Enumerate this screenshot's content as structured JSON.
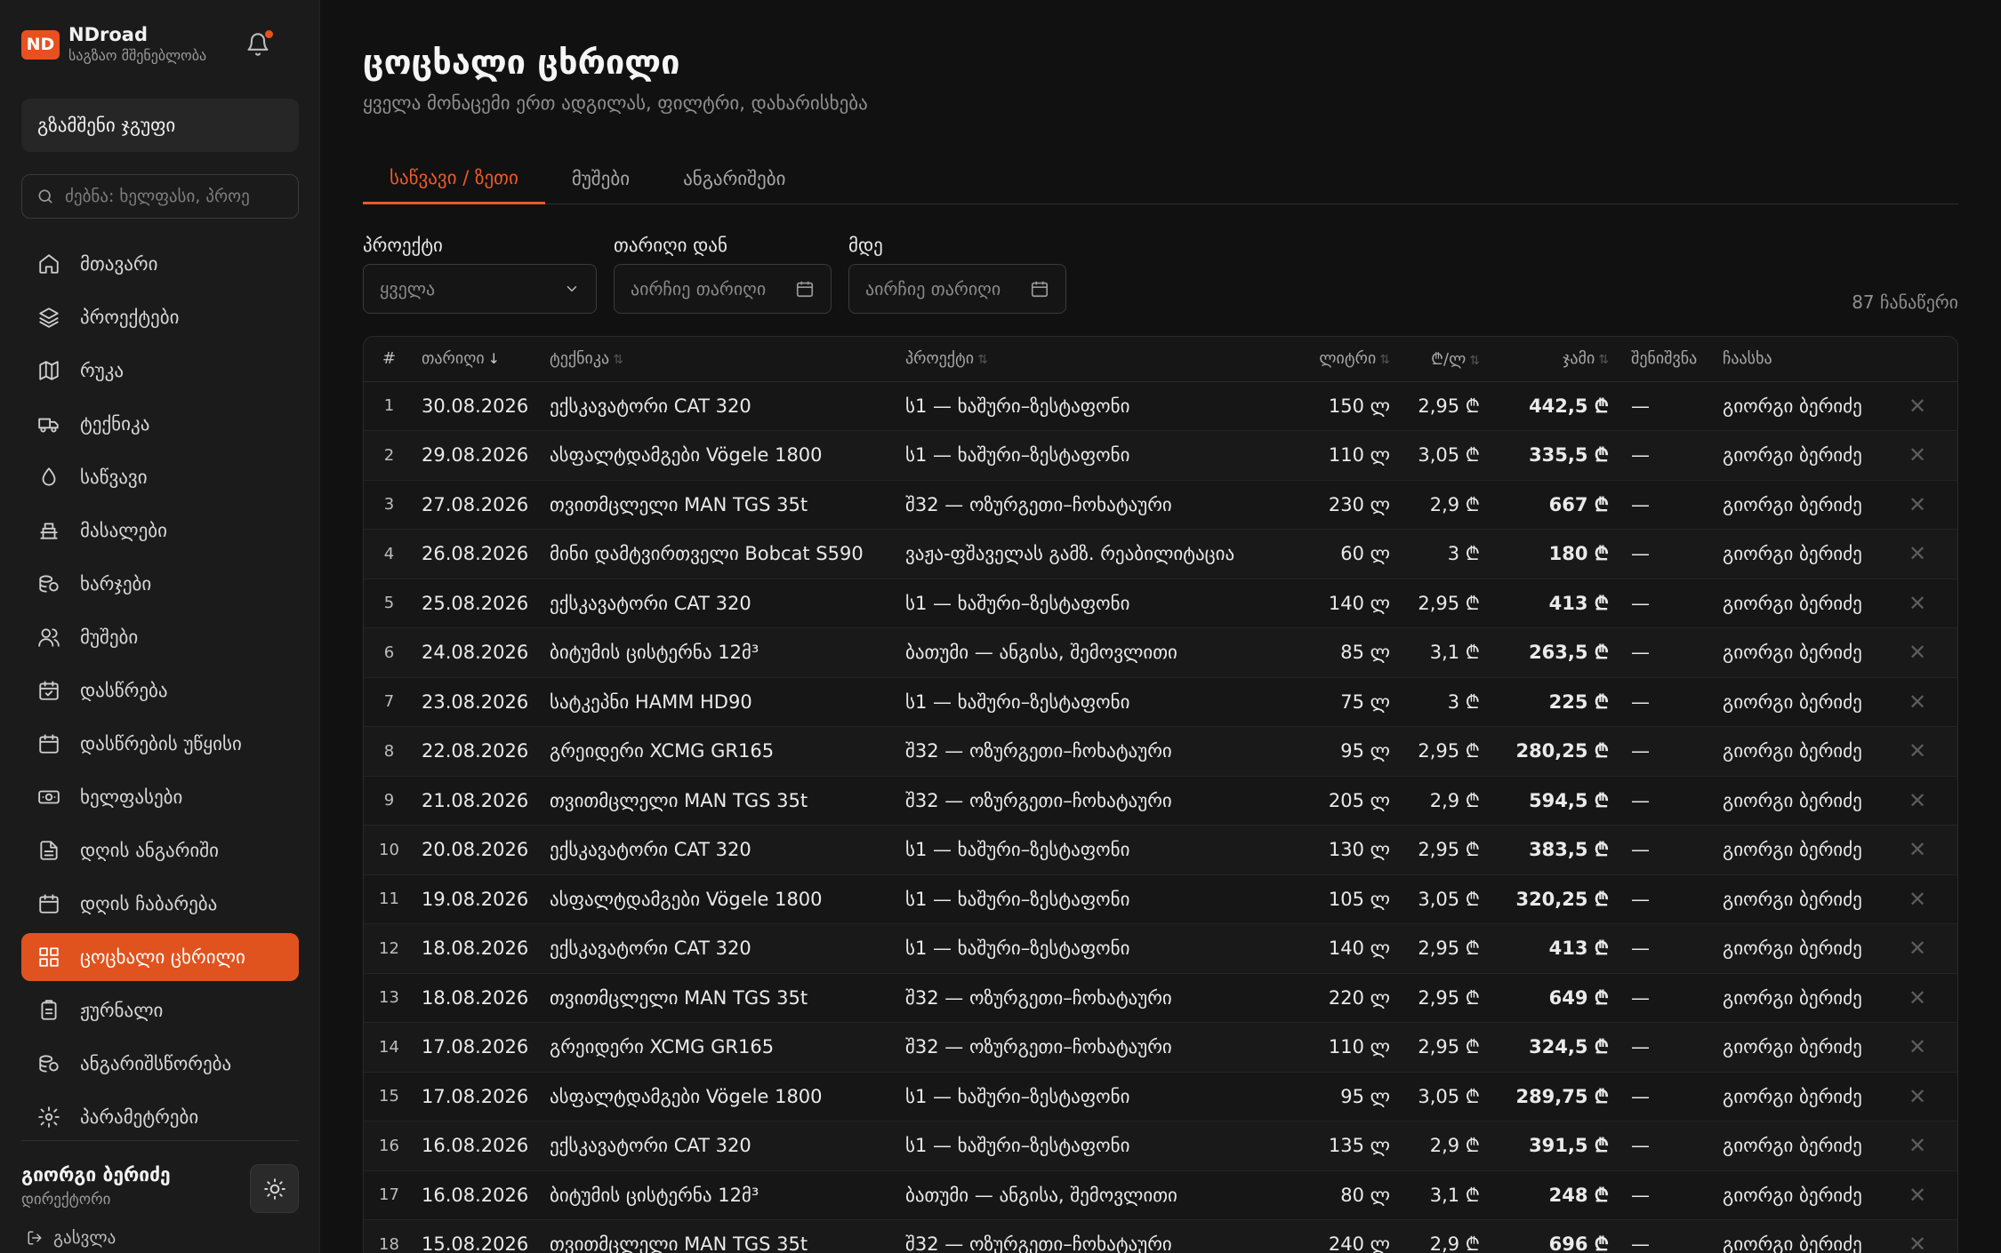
{
  "brand": {
    "logo": "ND",
    "name": "NDroad",
    "subtitle": "საგზაო მშენებლობა"
  },
  "sidebar": {
    "group_label": "გზამშენი ჯგუფი",
    "search_placeholder": "ძებნა: ხელფასი, პროე",
    "items": [
      {
        "label": "მთავარი",
        "icon": "home-icon"
      },
      {
        "label": "პროექტები",
        "icon": "layers-icon"
      },
      {
        "label": "რუკა",
        "icon": "map-icon"
      },
      {
        "label": "ტექნიკა",
        "icon": "truck-icon"
      },
      {
        "label": "საწვავი",
        "icon": "fuel-drop-icon"
      },
      {
        "label": "მასალები",
        "icon": "materials-icon"
      },
      {
        "label": "ხარჯები",
        "icon": "coins-icon"
      },
      {
        "label": "მუშები",
        "icon": "users-icon"
      },
      {
        "label": "დასწრება",
        "icon": "calendar-check-icon"
      },
      {
        "label": "დასწრების უწყისი",
        "icon": "calendar-icon"
      },
      {
        "label": "ხელფასები",
        "icon": "banknote-icon"
      },
      {
        "label": "დღის ანგარიში",
        "icon": "file-text-icon"
      },
      {
        "label": "დღის ჩაბარება",
        "icon": "calendar-icon"
      },
      {
        "label": "ცოცხალი ცხრილი",
        "icon": "grid-icon",
        "active": true
      },
      {
        "label": "ჟურნალი",
        "icon": "clipboard-icon"
      },
      {
        "label": "ანგარიშსწორება",
        "icon": "coins-icon"
      },
      {
        "label": "პარამეტრები",
        "icon": "gear-icon"
      }
    ],
    "user": {
      "name": "გიორგი ბერიძე",
      "role": "დირექტორი"
    },
    "logout_label": "გასვლა"
  },
  "page": {
    "title": "ცოცხალი ცხრილი",
    "subtitle": "ყველა მონაცემი ერთ ადგილას, ფილტრი, დახარისხება"
  },
  "tabs": [
    "საწვავი / ზეთი",
    "მუშები",
    "ანგარიშები"
  ],
  "filters": {
    "project_label": "პროექტი",
    "project_value": "ყველა",
    "date_from_label": "თარიღი დან",
    "date_to_label": "მდე",
    "date_placeholder": "აირჩიე თარიღი"
  },
  "record_count": "87 ჩანაწერი",
  "table": {
    "headers": {
      "idx": "#",
      "date": "თარიღი",
      "machine": "ტექნიკა",
      "project": "პროექტი",
      "liters": "ლიტრი",
      "price": "₾/ლ",
      "total": "ჯამი",
      "note": "შენიშვნა",
      "added_by": "ჩაასხა"
    },
    "sort_desc_glyph": "↓",
    "sort_glyph": "⇅",
    "rows": [
      {
        "n": "1",
        "date": "30.08.2026",
        "machine": "ექსკავატორი CAT 320",
        "project": "ს1 — ხაშური–ზესტაფონი",
        "liters": "150 ლ",
        "price": "2,95 ₾",
        "total": "442,5 ₾",
        "note": "—",
        "by": "გიორგი ბერიძე"
      },
      {
        "n": "2",
        "date": "29.08.2026",
        "machine": "ასფალტდამგები Vögele 1800",
        "project": "ს1 — ხაშური–ზესტაფონი",
        "liters": "110 ლ",
        "price": "3,05 ₾",
        "total": "335,5 ₾",
        "note": "—",
        "by": "გიორგი ბერიძე"
      },
      {
        "n": "3",
        "date": "27.08.2026",
        "machine": "თვითმცლელი MAN TGS 35t",
        "project": "შ32 — ოზურგეთი–ჩოხატაური",
        "liters": "230 ლ",
        "price": "2,9 ₾",
        "total": "667 ₾",
        "note": "—",
        "by": "გიორგი ბერიძე"
      },
      {
        "n": "4",
        "date": "26.08.2026",
        "machine": "მინი დამტვირთველი Bobcat S590",
        "project": "ვაჟა-ფშაველას გამზ. რეაბილიტაცია",
        "liters": "60 ლ",
        "price": "3 ₾",
        "total": "180 ₾",
        "note": "—",
        "by": "გიორგი ბერიძე"
      },
      {
        "n": "5",
        "date": "25.08.2026",
        "machine": "ექსკავატორი CAT 320",
        "project": "ს1 — ხაშური–ზესტაფონი",
        "liters": "140 ლ",
        "price": "2,95 ₾",
        "total": "413 ₾",
        "note": "—",
        "by": "გიორგი ბერიძე"
      },
      {
        "n": "6",
        "date": "24.08.2026",
        "machine": "ბიტუმის ცისტერნა 12მ³",
        "project": "ბათუმი — ანგისა, შემოვლითი",
        "liters": "85 ლ",
        "price": "3,1 ₾",
        "total": "263,5 ₾",
        "note": "—",
        "by": "გიორგი ბერიძე"
      },
      {
        "n": "7",
        "date": "23.08.2026",
        "machine": "სატკეპნი HAMM HD90",
        "project": "ს1 — ხაშური–ზესტაფონი",
        "liters": "75 ლ",
        "price": "3 ₾",
        "total": "225 ₾",
        "note": "—",
        "by": "გიორგი ბერიძე"
      },
      {
        "n": "8",
        "date": "22.08.2026",
        "machine": "გრეიდერი XCMG GR165",
        "project": "შ32 — ოზურგეთი–ჩოხატაური",
        "liters": "95 ლ",
        "price": "2,95 ₾",
        "total": "280,25 ₾",
        "note": "—",
        "by": "გიორგი ბერიძე"
      },
      {
        "n": "9",
        "date": "21.08.2026",
        "machine": "თვითმცლელი MAN TGS 35t",
        "project": "შ32 — ოზურგეთი–ჩოხატაური",
        "liters": "205 ლ",
        "price": "2,9 ₾",
        "total": "594,5 ₾",
        "note": "—",
        "by": "გიორგი ბერიძე"
      },
      {
        "n": "10",
        "date": "20.08.2026",
        "machine": "ექსკავატორი CAT 320",
        "project": "ს1 — ხაშური–ზესტაფონი",
        "liters": "130 ლ",
        "price": "2,95 ₾",
        "total": "383,5 ₾",
        "note": "—",
        "by": "გიორგი ბერიძე"
      },
      {
        "n": "11",
        "date": "19.08.2026",
        "machine": "ასფალტდამგები Vögele 1800",
        "project": "ს1 — ხაშური–ზესტაფონი",
        "liters": "105 ლ",
        "price": "3,05 ₾",
        "total": "320,25 ₾",
        "note": "—",
        "by": "გიორგი ბერიძე"
      },
      {
        "n": "12",
        "date": "18.08.2026",
        "machine": "ექსკავატორი CAT 320",
        "project": "ს1 — ხაშური–ზესტაფონი",
        "liters": "140 ლ",
        "price": "2,95 ₾",
        "total": "413 ₾",
        "note": "—",
        "by": "გიორგი ბერიძე"
      },
      {
        "n": "13",
        "date": "18.08.2026",
        "machine": "თვითმცლელი MAN TGS 35t",
        "project": "შ32 — ოზურგეთი–ჩოხატაური",
        "liters": "220 ლ",
        "price": "2,95 ₾",
        "total": "649 ₾",
        "note": "—",
        "by": "გიორგი ბერიძე"
      },
      {
        "n": "14",
        "date": "17.08.2026",
        "machine": "გრეიდერი XCMG GR165",
        "project": "შ32 — ოზურგეთი–ჩოხატაური",
        "liters": "110 ლ",
        "price": "2,95 ₾",
        "total": "324,5 ₾",
        "note": "—",
        "by": "გიორგი ბერიძე"
      },
      {
        "n": "15",
        "date": "17.08.2026",
        "machine": "ასფალტდამგები Vögele 1800",
        "project": "ს1 — ხაშური–ზესტაფონი",
        "liters": "95 ლ",
        "price": "3,05 ₾",
        "total": "289,75 ₾",
        "note": "—",
        "by": "გიორგი ბერიძე"
      },
      {
        "n": "16",
        "date": "16.08.2026",
        "machine": "ექსკავატორი CAT 320",
        "project": "ს1 — ხაშური–ზესტაფონი",
        "liters": "135 ლ",
        "price": "2,9 ₾",
        "total": "391,5 ₾",
        "note": "—",
        "by": "გიორგი ბერიძე"
      },
      {
        "n": "17",
        "date": "16.08.2026",
        "machine": "ბიტუმის ცისტერნა 12მ³",
        "project": "ბათუმი — ანგისა, შემოვლითი",
        "liters": "80 ლ",
        "price": "3,1 ₾",
        "total": "248 ₾",
        "note": "—",
        "by": "გიორგი ბერიძე"
      },
      {
        "n": "18",
        "date": "15.08.2026",
        "machine": "თვითმცლელი MAN TGS 35t",
        "project": "შ32 — ოზურგეთი–ჩოხატაური",
        "liters": "240 ლ",
        "price": "2,9 ₾",
        "total": "696 ₾",
        "note": "—",
        "by": "გიორგი ბერიძე"
      }
    ],
    "delete_glyph": "✕"
  },
  "colors": {
    "accent": "#e0531f",
    "background": "#111111",
    "sidebar": "#1b1b1b"
  }
}
